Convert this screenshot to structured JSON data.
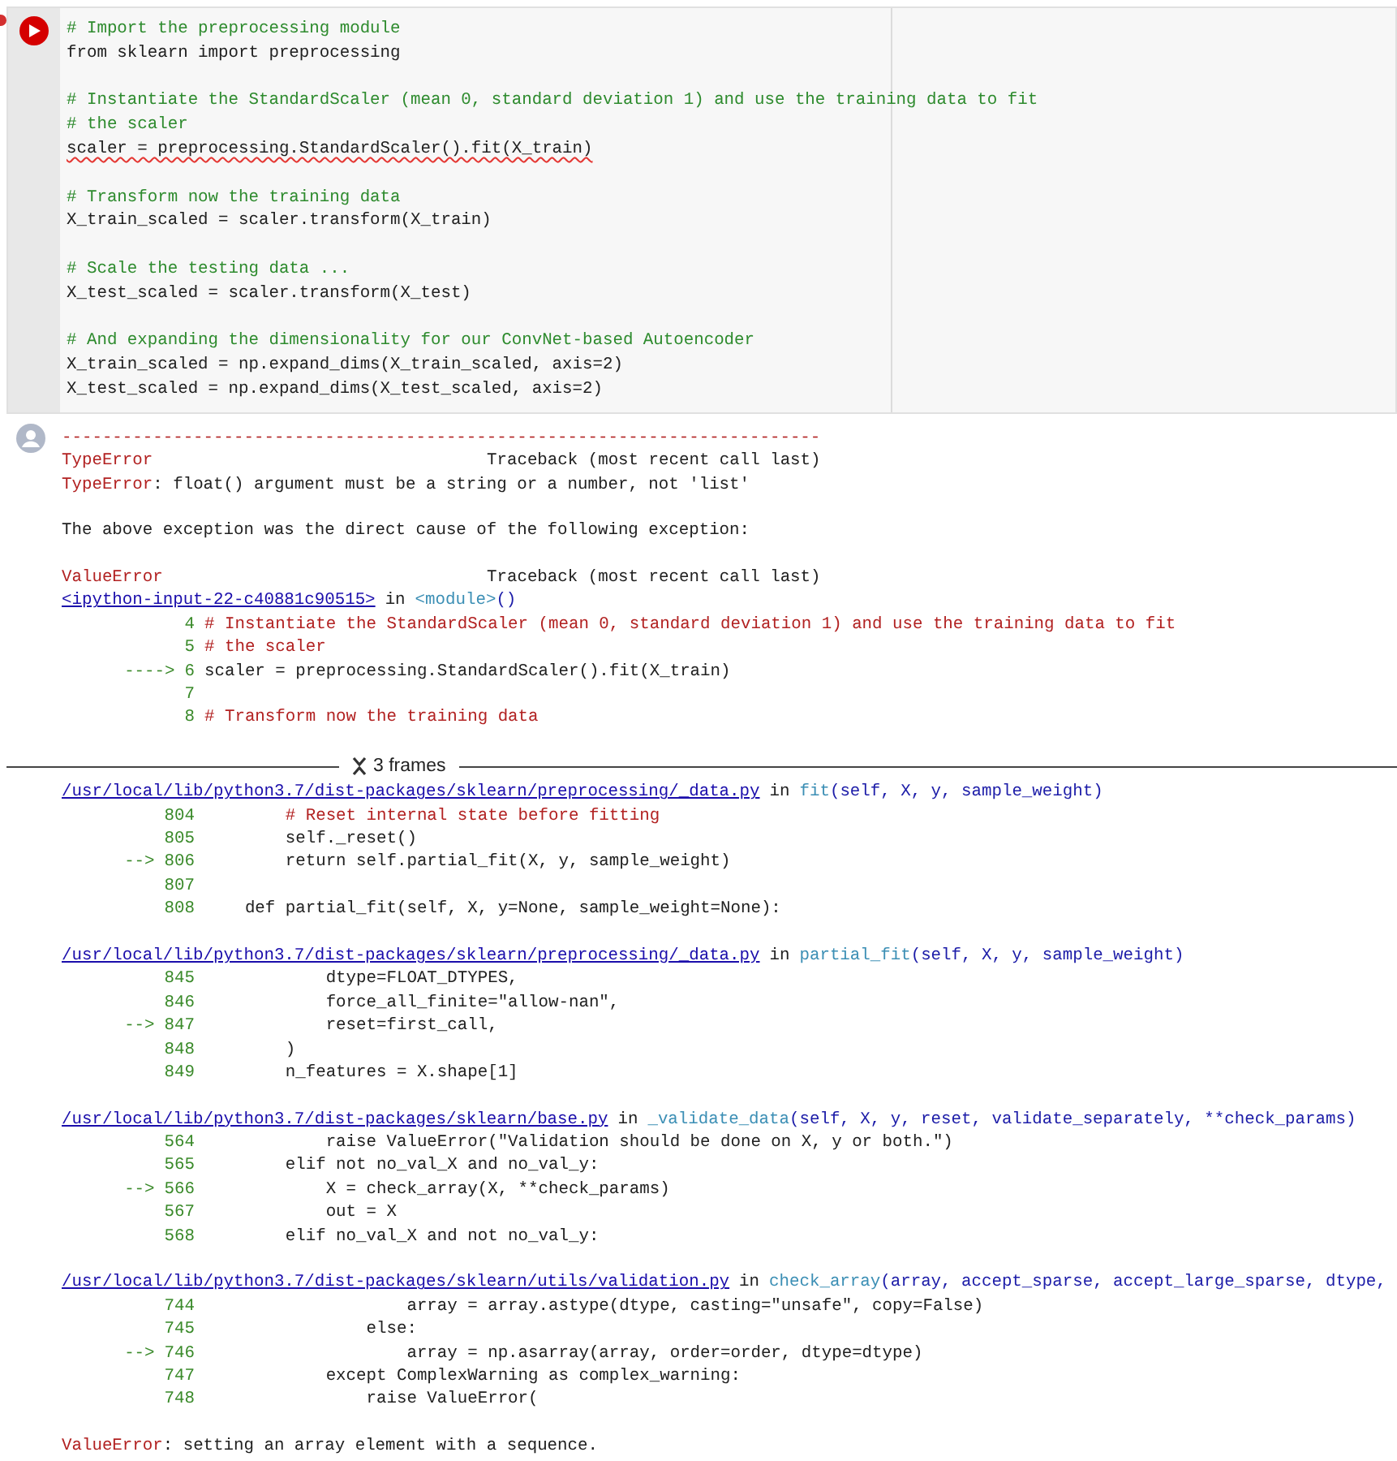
{
  "code_cell": {
    "run_button": {
      "running": true
    },
    "blocks": [
      [
        {
          "kind": "comment",
          "text": "# Import the preprocessing module"
        },
        {
          "kind": "code",
          "text": "from sklearn import preprocessing"
        }
      ],
      [
        {
          "kind": "comment",
          "text": "# Instantiate the StandardScaler (mean 0, standard deviation 1) and use the training data to fit"
        },
        {
          "kind": "comment",
          "text": "# the scaler"
        },
        {
          "kind": "code",
          "text": "scaler = preprocessing.StandardScaler().fit(X_train)",
          "lint_error": true
        }
      ],
      [
        {
          "kind": "comment",
          "text": "# Transform now the training data"
        },
        {
          "kind": "code",
          "text": "X_train_scaled = scaler.transform(X_train)"
        }
      ],
      [
        {
          "kind": "comment",
          "text": "# Scale the testing data ..."
        },
        {
          "kind": "code",
          "text": "X_test_scaled = scaler.transform(X_test)"
        }
      ],
      [
        {
          "kind": "comment",
          "text": "# And expanding the dimensionality for our ConvNet-based Autoencoder"
        },
        {
          "kind": "code",
          "text": "X_train_scaled = np.expand_dims(X_train_scaled, axis=2)"
        },
        {
          "kind": "code",
          "text": "X_test_scaled = np.expand_dims(X_test_scaled, axis=2)"
        }
      ]
    ]
  },
  "output": [
    [
      {
        "kind": "rule",
        "text": "---------------------------------------------------------------------------"
      },
      {
        "kind": "header",
        "error": "TypeError",
        "label": "Traceback (most recent call last)"
      },
      {
        "kind": "message",
        "error": "TypeError",
        "text": ": float() argument must be a string or a number, not 'list'"
      }
    ],
    [
      {
        "kind": "plain",
        "text": "The above exception was the direct cause of the following exception:"
      }
    ],
    [
      {
        "kind": "header",
        "error": "ValueError",
        "label": "Traceback (most recent call last)"
      },
      {
        "kind": "frame",
        "file": "<ipython-input-22-c40881c90515>",
        "in": "in",
        "func": "<module>",
        "args": "()",
        "lines": [
          {
            "number": "4",
            "kind": "comment",
            "text": "# Instantiate the StandardScaler (mean 0, standard deviation 1) and use the training data to fit"
          },
          {
            "number": "5",
            "kind": "comment",
            "text": "# the scaler"
          },
          {
            "marker": "---->",
            "number": "6",
            "kind": "code",
            "text": "scaler = preprocessing.StandardScaler().fit(X_train)"
          },
          {
            "number": "7"
          },
          {
            "number": "8",
            "kind": "comment",
            "text": "# Transform now the training data"
          }
        ]
      }
    ],
    [
      {
        "kind": "collapse",
        "label": "3 frames"
      },
      {
        "kind": "frame",
        "file": "/usr/local/lib/python3.7/dist-packages/sklearn/preprocessing/_data.py",
        "in": "in",
        "func": "fit",
        "args": "(self, X, y, sample_weight)",
        "lines": [
          {
            "number": "804",
            "kind": "comment",
            "text": "        # Reset internal state before fitting"
          },
          {
            "number": "805",
            "kind": "code",
            "text": "        self._reset()"
          },
          {
            "marker": "-->",
            "number": "806",
            "kind": "code",
            "text": "        return self.partial_fit(X, y, sample_weight)"
          },
          {
            "number": "807"
          },
          {
            "number": "808",
            "kind": "code",
            "text": "    def partial_fit(self, X, y=None, sample_weight=None):"
          }
        ]
      }
    ],
    [
      {
        "kind": "frame",
        "file": "/usr/local/lib/python3.7/dist-packages/sklearn/preprocessing/_data.py",
        "in": "in",
        "func": "partial_fit",
        "args": "(self, X, y, sample_weight)",
        "lines": [
          {
            "number": "845",
            "kind": "code",
            "text": "            dtype=FLOAT_DTYPES,"
          },
          {
            "number": "846",
            "kind": "code",
            "text": "            force_all_finite=\"allow-nan\","
          },
          {
            "marker": "-->",
            "number": "847",
            "kind": "code",
            "text": "            reset=first_call,"
          },
          {
            "number": "848",
            "kind": "code",
            "text": "        )"
          },
          {
            "number": "849",
            "kind": "code",
            "text": "        n_features = X.shape[1]"
          }
        ]
      }
    ],
    [
      {
        "kind": "frame",
        "file": "/usr/local/lib/python3.7/dist-packages/sklearn/base.py",
        "in": "in",
        "func": "_validate_data",
        "args": "(self, X, y, reset, validate_separately, **check_params)",
        "lines": [
          {
            "number": "564",
            "kind": "code",
            "text": "            raise ValueError(\"Validation should be done on X, y or both.\")"
          },
          {
            "number": "565",
            "kind": "code",
            "text": "        elif not no_val_X and no_val_y:"
          },
          {
            "marker": "-->",
            "number": "566",
            "kind": "code",
            "text": "            X = check_array(X, **check_params)"
          },
          {
            "number": "567",
            "kind": "code",
            "text": "            out = X"
          },
          {
            "number": "568",
            "kind": "code",
            "text": "        elif no_val_X and not no_val_y:"
          }
        ]
      }
    ],
    [
      {
        "kind": "frame",
        "file": "/usr/local/lib/python3.7/dist-packages/sklearn/utils/validation.py",
        "in": "in",
        "func": "check_array",
        "args": "(array, accept_sparse, accept_large_sparse, dtype,",
        "lines": [
          {
            "number": "744",
            "kind": "code",
            "text": "                    array = array.astype(dtype, casting=\"unsafe\", copy=False)"
          },
          {
            "number": "745",
            "kind": "code",
            "text": "                else:"
          },
          {
            "marker": "-->",
            "number": "746",
            "kind": "code",
            "text": "                    array = np.asarray(array, order=order, dtype=dtype)"
          },
          {
            "number": "747",
            "kind": "code",
            "text": "            except ComplexWarning as complex_warning:"
          },
          {
            "number": "748",
            "kind": "code",
            "text": "                raise ValueError("
          }
        ]
      }
    ],
    [
      {
        "kind": "message",
        "error": "ValueError",
        "text": ": setting an array element with a sequence."
      }
    ]
  ]
}
